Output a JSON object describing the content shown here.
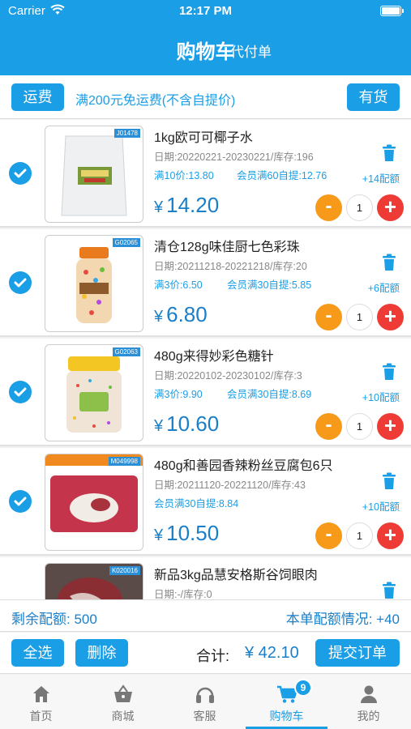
{
  "status_bar": {
    "carrier": "Carrier",
    "time": "12:17 PM"
  },
  "header": {
    "title": "购物车",
    "right_link": "代付单"
  },
  "shipping": {
    "button": "运费",
    "notice": "满200元免运费(不含自提价)",
    "stock_button": "有货"
  },
  "items": [
    {
      "sku": "J01478",
      "name": "1kg欧可可椰子水",
      "date": "日期:20220221-20230221/库存:196",
      "promo1": "满10价:13.80",
      "promo2": "会员满60自提:12.76",
      "extra": "+14配额",
      "currency": "¥",
      "price": "14.20",
      "qty": "1"
    },
    {
      "sku": "G02065",
      "name": "清仓128g味佳厨七色彩珠",
      "date": "日期:20211218-20221218/库存:20",
      "promo1": "满3价:6.50",
      "promo2": "会员满30自提:5.85",
      "extra": "+6配额",
      "currency": "¥",
      "price": "6.80",
      "qty": "1"
    },
    {
      "sku": "G02063",
      "name": "480g来得妙彩色糖针",
      "date": "日期:20220102-20230102/库存:3",
      "promo1": "满3价:9.90",
      "promo2": "会员满30自提:8.69",
      "extra": "+10配额",
      "currency": "¥",
      "price": "10.60",
      "qty": "1"
    },
    {
      "sku": "M049998",
      "name": "480g和善园香辣粉丝豆腐包6只",
      "date": "日期:20211120-20221120/库存:43",
      "promo1": "会员满30自提:8.84",
      "promo2": "",
      "extra": "+10配额",
      "currency": "¥",
      "price": "10.50",
      "qty": "1"
    },
    {
      "sku": "K020016",
      "name": "新品3kg品慧安格斯谷饲眼肉",
      "date": "日期:-/库存:0",
      "promo1": "",
      "promo2": "",
      "extra": "",
      "currency": "",
      "price": "",
      "qty": ""
    }
  ],
  "quota": {
    "remaining": "剩余配额: 500",
    "order": "本单配额情况: +40"
  },
  "actions": {
    "select_all": "全选",
    "delete": "删除",
    "total_label": "合计:",
    "total_value": "¥ 42.10",
    "submit": "提交订单"
  },
  "tabs": [
    {
      "label": "首页",
      "icon": "home-icon"
    },
    {
      "label": "商城",
      "icon": "basket-icon"
    },
    {
      "label": "客服",
      "icon": "headset-icon"
    },
    {
      "label": "购物车",
      "icon": "cart-icon",
      "badge": "9"
    },
    {
      "label": "我的",
      "icon": "person-icon"
    }
  ],
  "colors": {
    "primary": "#1a9ee6",
    "price": "#1a7fc8",
    "minus": "#f79a1a",
    "plus": "#ee3b35"
  }
}
